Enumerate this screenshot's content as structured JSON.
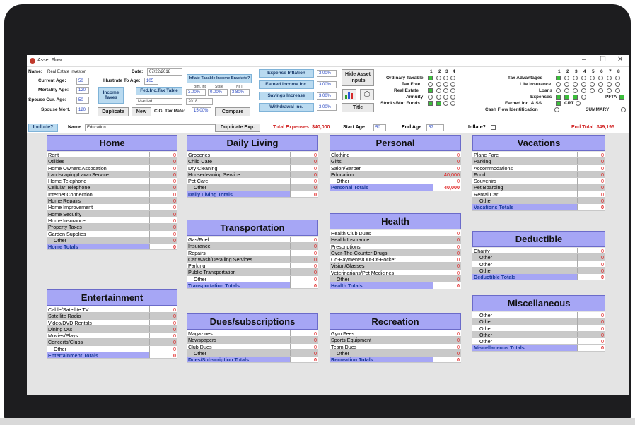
{
  "window": {
    "title": "Asset Flow",
    "minimize": "–",
    "maximize": "☐",
    "close": "✕"
  },
  "header": {
    "name_label": "Name:",
    "name_value": "Real Estate Investor",
    "date_label": "Date:",
    "date_value": "07/22/2018",
    "current_age_label": "Current Age:",
    "current_age": "50",
    "illustrate_label": "Illustrate To Age:",
    "illustrate_age": "105",
    "mortality_label": "Mortality Age:",
    "mortality_age": "120",
    "spouse_age_label": "Spouse Cur. Age:",
    "spouse_age": "50",
    "spouse_mort_label": "Spouse Mort.",
    "spouse_mort": "120",
    "inflate_brackets_btn": "Inflate Taxable Income Brackets?",
    "income_taxes_btn": "Income Taxes",
    "fed_table_btn": "Fed.Inc.Tax Table",
    "bmi_label": "Bmi. Int",
    "state_label": "State",
    "niit_label": "NIIT",
    "bmi_value": "3.00%",
    "state_value": "0.00%",
    "niit_value": "3.80%",
    "filing_status": "Married",
    "tax_year": "2018",
    "cg_label": "C.G. Tax Rate:",
    "cg_value": "15.00%",
    "duplicate_btn": "Duplicate",
    "new_btn": "New",
    "compare_btn": "Compare",
    "expense_inflation_btn": "Expense Inflation",
    "expense_inflation": "3.00%",
    "earned_income_btn": "Earned Income Inc.",
    "earned_income": "3.00%",
    "savings_btn": "Savings Increase",
    "savings": "3.00%",
    "withdrawal_btn": "Withdrawal Inc.",
    "withdrawal": "3.00%",
    "hide_asset_btn": "Hide Asset Inputs",
    "title_btn": "Title",
    "cols_left": [
      "1",
      "2",
      "3",
      "4"
    ],
    "cols_right": [
      "1",
      "2",
      "3",
      "4",
      "5",
      "6",
      "7",
      "8"
    ],
    "ordinary": "Ordinary Taxable",
    "tax_free": "Tax Free",
    "real_estate": "Real Estate",
    "annuity": "Annuity",
    "stocks": "Stocks/Mut.Funds",
    "tax_adv": "Tax Advantaged",
    "life_ins": "Life Insurance",
    "loans": "Loans",
    "expenses": "Expenses",
    "pfta": "PFTA",
    "earned_ss": "Earned Inc. & SS",
    "crt": "CRT",
    "cash_flow": "Cash Flow Identification",
    "summary": "SUMMARY"
  },
  "bar": {
    "include_btn": "Include?",
    "name_label": "Name:",
    "name_value": "Education",
    "dup_exp_btn": "Duplicate Exp.",
    "total_expenses": "Total Expenses: $40,000",
    "start_age_label": "Start Age:",
    "start_age": "50",
    "end_age_label": "End Age:",
    "end_age": "57",
    "inflate_label": "Inflate?",
    "end_total": "End Total: $49,195"
  },
  "sections": {
    "home": {
      "title": "Home",
      "rows": [
        "Rent",
        "Utilities",
        "Home Owners Assocation",
        "Landscaping/Lawn Service",
        "Home Telephone",
        "Cellular Telephone",
        "Internet Connection",
        "Home Repairs",
        "Home Improvement",
        "Home Security",
        "Home Insurance",
        "Property Taxes",
        "Garden Supplies",
        "Other"
      ],
      "values": [
        "0",
        "0",
        "0",
        "0",
        "0",
        "0",
        "0",
        "0",
        "0",
        "0",
        "0",
        "0",
        "0",
        "0"
      ],
      "total_label": "Home Totals",
      "total": "0"
    },
    "entertainment": {
      "title": "Entertainment",
      "rows": [
        "Cable/Satellite TV",
        "Satellite Radio",
        "Video/DVD Rentals",
        "Dining Out",
        "Movies/Plays",
        "Concerts/Clubs",
        "Other"
      ],
      "values": [
        "0",
        "0",
        "0",
        "0",
        "0",
        "0",
        "0"
      ],
      "total_label": "Entertainment Totals",
      "total": "0"
    },
    "daily": {
      "title": "Daily Living",
      "rows": [
        "Groceries",
        "Child Care",
        "Dry Cleaning",
        "Housecleaning Service",
        "Pet Care",
        "Other"
      ],
      "values": [
        "0",
        "0",
        "0",
        "0",
        "0",
        "0"
      ],
      "total_label": "Daily Living Totals",
      "total": "0"
    },
    "transport": {
      "title": "Transportation",
      "rows": [
        "Gas/Fuel",
        "Insurance",
        "Repairs",
        "Car Wash/Detailing Services",
        "Parking",
        "Public Transportation",
        "Other"
      ],
      "values": [
        "0",
        "0",
        "0",
        "0",
        "0",
        "0",
        "0"
      ],
      "total_label": "Transportation Totals",
      "total": "0"
    },
    "dues": {
      "title": "Dues/subscriptions",
      "rows": [
        "Magazines",
        "Newspapers",
        "Club Dues",
        "Other"
      ],
      "values": [
        "0",
        "0",
        "0",
        "0"
      ],
      "total_label": "Dues/Subscription Totals",
      "total": "0"
    },
    "personal": {
      "title": "Personal",
      "rows": [
        "Clothing",
        "Gifts",
        "Salon/Barber",
        "Education",
        "Other"
      ],
      "values": [
        "0",
        "0",
        "0",
        "40,000",
        "0"
      ],
      "total_label": "Personal Totals",
      "total": "40,000"
    },
    "health": {
      "title": "Health",
      "rows": [
        "Health Club Dues",
        "Health Insurance",
        "Prescriptions",
        "Over-The-Counter Drugs",
        "Co-Payments/Out-Of-Pocket",
        "Vision/Glasses",
        "Veterinarians/Pet Medicines",
        "Other"
      ],
      "values": [
        "0",
        "0",
        "0",
        "0",
        "0",
        "0",
        "0",
        "0"
      ],
      "total_label": "Health Totals",
      "total": "0"
    },
    "recreation": {
      "title": "Recreation",
      "rows": [
        "Gym Fees",
        "Sports Equipment",
        "Team Dues",
        "Other"
      ],
      "values": [
        "0",
        "0",
        "0",
        "0"
      ],
      "total_label": "Recreation Totals",
      "total": "0"
    },
    "vacations": {
      "title": "Vacations",
      "rows": [
        "Plane Fare",
        "Parking",
        "Accommodations",
        "Food",
        "Souvenirs",
        "Pet Boarding",
        "Rental Car",
        "Other"
      ],
      "values": [
        "0",
        "0",
        "0",
        "0",
        "0",
        "0",
        "0",
        "0"
      ],
      "total_label": "Vacations Totals",
      "total": "0"
    },
    "deductible": {
      "title": "Deductible",
      "rows": [
        "Charity",
        "Other",
        "Other",
        "Other"
      ],
      "values": [
        "0",
        "0",
        "0",
        "0"
      ],
      "total_label": "Deductible Totals",
      "total": "0"
    },
    "misc": {
      "title": "Miscellaneous",
      "rows": [
        "Other",
        "Other",
        "Other",
        "Other",
        "Other"
      ],
      "values": [
        "0",
        "0",
        "0",
        "0",
        "0"
      ],
      "total_label": "Miscellaneous Totals",
      "total": "0"
    }
  }
}
